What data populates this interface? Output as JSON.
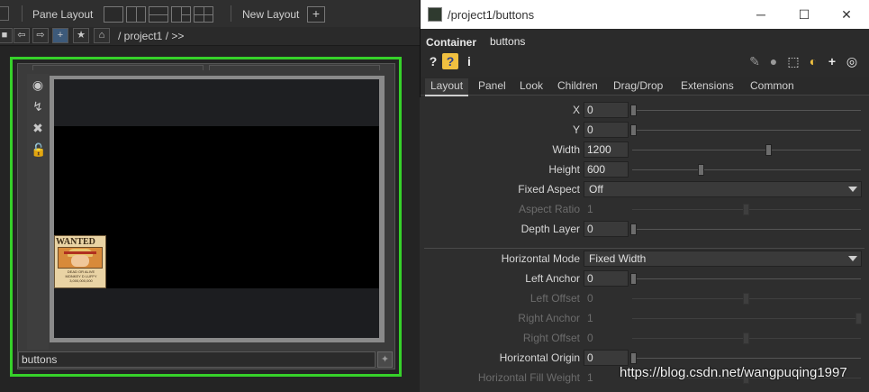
{
  "toolbar": {
    "pane_layout_label": "Pane Layout",
    "new_layout_label": "New Layout"
  },
  "path": {
    "text": "/ project1 / >>"
  },
  "node": {
    "name": "buttons",
    "image_text": [
      "WANTED",
      "DEAD OR ALIVE",
      "MONKEY D LUFFY",
      "3,000,000,000"
    ]
  },
  "param_window": {
    "title": "/project1/buttons",
    "op_type": "Container",
    "op_name": "buttons",
    "tabs": [
      "Layout",
      "Panel",
      "Look",
      "Children",
      "Drag/Drop",
      "Extensions",
      "Common"
    ],
    "active_tab": "Layout",
    "params": [
      {
        "label": "X",
        "value": "0",
        "kind": "slider",
        "level": 0,
        "enabled": true
      },
      {
        "label": "Y",
        "value": "0",
        "kind": "slider",
        "level": 0,
        "enabled": true
      },
      {
        "label": "Width",
        "value": "1200",
        "kind": "slider",
        "level": 0.6,
        "enabled": true
      },
      {
        "label": "Height",
        "value": "600",
        "kind": "slider",
        "level": 0.3,
        "enabled": true
      },
      {
        "label": "Fixed Aspect",
        "value": "Off",
        "kind": "menu",
        "enabled": true
      },
      {
        "label": "Aspect Ratio",
        "value": "1",
        "kind": "slider",
        "level": 0.5,
        "enabled": false
      },
      {
        "label": "Depth Layer",
        "value": "0",
        "kind": "slider",
        "level": 0,
        "enabled": true
      },
      {
        "label": "Horizontal Mode",
        "value": "Fixed Width",
        "kind": "menu",
        "enabled": true
      },
      {
        "label": "Left Anchor",
        "value": "0",
        "kind": "slider",
        "level": 0,
        "enabled": true
      },
      {
        "label": "Left Offset",
        "value": "0",
        "kind": "slider",
        "level": 0.5,
        "enabled": false
      },
      {
        "label": "Right Anchor",
        "value": "1",
        "kind": "slider",
        "level": 1,
        "enabled": false
      },
      {
        "label": "Right Offset",
        "value": "0",
        "kind": "slider",
        "level": 0.5,
        "enabled": false
      },
      {
        "label": "Horizontal Origin",
        "value": "0",
        "kind": "slider",
        "level": 0,
        "enabled": true
      },
      {
        "label": "Horizontal Fill Weight",
        "value": "1",
        "kind": "slider",
        "level": 0.5,
        "enabled": false
      }
    ]
  },
  "watermark": "https://blog.csdn.net/wangpuqing1997",
  "colors": {
    "selection": "#36d12a",
    "background": "#1b1b1b",
    "panel": "#2e2e2e"
  }
}
